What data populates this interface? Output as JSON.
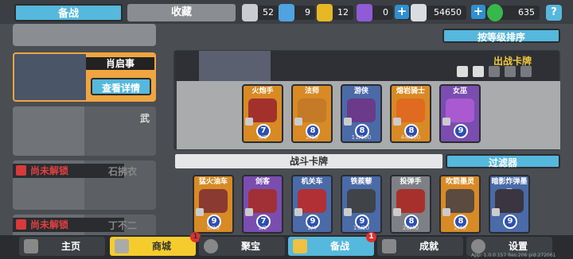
{
  "tabs": {
    "deck": "备战",
    "collection": "收藏"
  },
  "resources": [
    {
      "name": "silver-trophy",
      "value": "52",
      "color": "#c9cdd2"
    },
    {
      "name": "blue-trophy",
      "value": "9",
      "color": "#4fa3e0"
    },
    {
      "name": "gold-trophy",
      "value": "12",
      "color": "#e7b824"
    },
    {
      "name": "purple-trophy",
      "value": "0",
      "color": "#8f5bd6"
    },
    {
      "name": "coin",
      "value": "54650",
      "color": "#d9dde2"
    },
    {
      "name": "gem",
      "value": "635",
      "color": "#38b84a"
    }
  ],
  "help_label": "?",
  "sort_label": "按等级排序",
  "hero_selected": {
    "name": "肖启事",
    "detail_label": "查看详情"
  },
  "hero_list": [
    {
      "name": "武",
      "locked": false
    },
    {
      "name": "石拂衣",
      "locked": true,
      "lock_text": "尚未解锁"
    },
    {
      "name": "丁不二",
      "locked": true,
      "lock_text": "尚未解锁"
    }
  ],
  "deck_title": "出战卡牌",
  "deck_cards": [
    {
      "name": "火炮手",
      "cost": "7",
      "count": "8/6",
      "color": "orange"
    },
    {
      "name": "法师",
      "cost": "8",
      "count": "2/10",
      "color": "orange"
    },
    {
      "name": "游侠",
      "cost": "8",
      "count": "11/100",
      "color": "blue"
    },
    {
      "name": "熔岩骑士",
      "cost": "8",
      "count": "44/100",
      "color": "orange"
    },
    {
      "name": "女巫",
      "cost": "9",
      "count": "",
      "color": "purple"
    }
  ],
  "battle_title": "战斗卡牌",
  "filter_label": "过滤器",
  "battle_cards": [
    {
      "name": "猛火油车",
      "cost": "9",
      "count": "0/16",
      "color": "orange"
    },
    {
      "name": "剑客",
      "cost": "7",
      "count": "1/2",
      "color": "purple"
    },
    {
      "name": "机关车",
      "cost": "9",
      "count": "2/4",
      "color": "blue"
    },
    {
      "name": "铁蒺藜",
      "cost": "9",
      "count": "19/20",
      "color": "blue"
    },
    {
      "name": "投弹手",
      "cost": "8",
      "count": "20/40",
      "color": "grey"
    },
    {
      "name": "吹箭墨灵",
      "cost": "8",
      "count": "2/40",
      "color": "orange"
    },
    {
      "name": "暗影炸弹墨灵",
      "cost": "9",
      "count": "",
      "color": "blue"
    }
  ],
  "nav": [
    {
      "name": "home",
      "label": "主页",
      "badge": ""
    },
    {
      "name": "shop",
      "label": "商城",
      "badge": "1",
      "active": true
    },
    {
      "name": "treasure",
      "label": "聚宝",
      "badge": ""
    },
    {
      "name": "deck",
      "label": "备战",
      "badge": "1"
    },
    {
      "name": "achievements",
      "label": "成就",
      "badge": ""
    },
    {
      "name": "settings",
      "label": "设置",
      "badge": ""
    }
  ],
  "version": "App: 1.0.0.157 Res:206 pid:272061"
}
